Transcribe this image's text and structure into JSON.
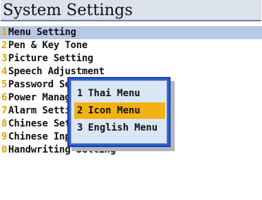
{
  "title": "System Settings",
  "menu_items": [
    {
      "num": "1",
      "label": "Menu Setting"
    },
    {
      "num": "2",
      "label": "Pen & Key Tone"
    },
    {
      "num": "3",
      "label": "Picture Setting"
    },
    {
      "num": "4",
      "label": "Speech Adjustment"
    },
    {
      "num": "5",
      "label": "Password Setting"
    },
    {
      "num": "6",
      "label": "Power Management"
    },
    {
      "num": "7",
      "label": "Alarm Setting"
    },
    {
      "num": "8",
      "label": "Chinese Setting"
    },
    {
      "num": "9",
      "label": "Chinese Input Method Setting"
    },
    {
      "num": "0",
      "label": "Handwriting Setting"
    }
  ],
  "popup": {
    "items": [
      {
        "num": "1",
        "label": "Thai Menu"
      },
      {
        "num": "2",
        "label": "Icon Menu"
      },
      {
        "num": "3",
        "label": "English Menu"
      }
    ]
  },
  "colors": {
    "number": "#e8a000",
    "selection": "#b7c8e6",
    "popup_border": "#2d61d6",
    "popup_highlight": "#f2b215"
  }
}
